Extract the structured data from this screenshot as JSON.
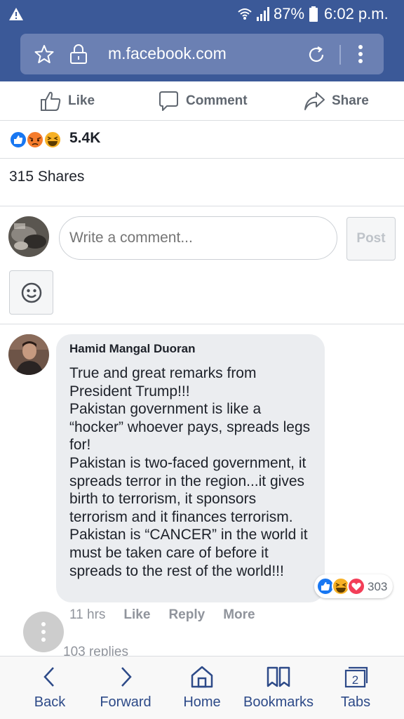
{
  "status_bar": {
    "battery": "87%",
    "time": "6:02 p.m."
  },
  "url_bar": {
    "url": "m.facebook.com"
  },
  "post_actions": {
    "like": "Like",
    "comment": "Comment",
    "share": "Share"
  },
  "reactions": {
    "count": "5.4K",
    "icons": [
      "like-reaction-icon",
      "angry-reaction-icon",
      "haha-reaction-icon"
    ]
  },
  "shares": {
    "text": "315 Shares"
  },
  "composer": {
    "placeholder": "Write a comment...",
    "post_label": "Post"
  },
  "comment": {
    "author": "Hamid Mangal Duoran",
    "body": "True and great remarks from President Trump!!!\nPakistan government is like a “hocker” whoever pays, spreads legs for!\nPakistan is two-faced government, it spreads terror in the region...it gives birth to terrorism, it sponsors terrorism and it finances terrorism.\nPakistan is “CANCER” in the world it must be taken care of before it spreads to the rest of the world!!!",
    "reaction_count": "303",
    "time": "11 hrs",
    "like": "Like",
    "reply": "Reply",
    "more": "More",
    "replies": "103 replies"
  },
  "bottom_nav": {
    "back": "Back",
    "forward": "Forward",
    "home": "Home",
    "bookmarks": "Bookmarks",
    "tabs": "Tabs",
    "tab_count": "2"
  },
  "colors": {
    "brand": "#3b5998",
    "like_blue": "#1877f2",
    "love_red": "#f33e58",
    "haha_yellow": "#f7b125"
  }
}
